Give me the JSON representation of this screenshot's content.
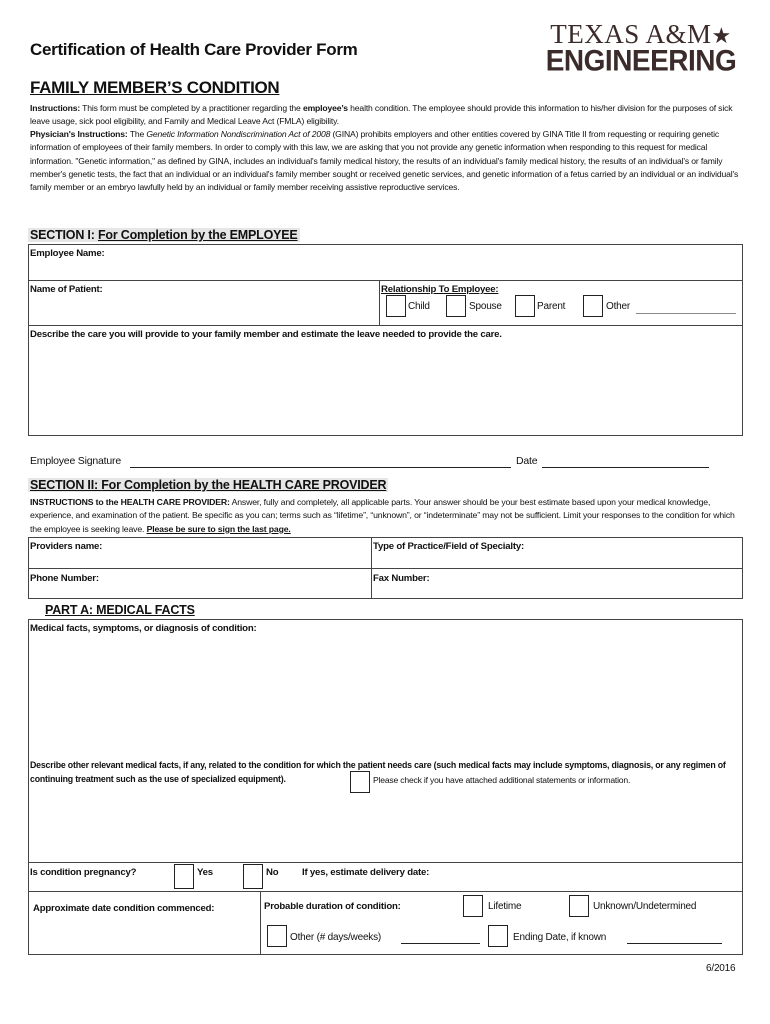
{
  "header": {
    "title": "Certification of Health Care Provider Form",
    "subtitle": "FAMILY MEMBER’S CONDITION",
    "logo_line1": "TEXAS A&M",
    "logo_star": "★",
    "logo_line2": "ENGINEERING"
  },
  "instructions": {
    "label": "Instructions:",
    "text_a": " This form must be completed by a practitioner regarding the ",
    "employee_bold": "employee’s",
    "text_b": " health condition. The employee should provide this information to his/her division for the purposes of sick leave usage, sick pool eligibility, and Family and Medical Leave Act (FMLA) eligibility.",
    "physician_label": "Physician's Instructions:",
    "physician_a": " The ",
    "gina_italic": "Genetic Information Nondiscrimination Act of 2008",
    "physician_b": " (GINA) prohibits employers and other entities covered by GINA Title II from requesting or requiring genetic information of employees of their family members. In order to comply with this law, we are asking that you not provide any genetic information when responding to this request for medical information. \"Genetic information,\" as defined by GINA, includes an individual's family medical history, the results of an individual's family medical history, the results of an individual's or family member's genetic tests, the fact that an individual or an individual's family member sought or received genetic services, and genetic information of a fetus carried by an individual or an individual's family member or an embryo lawfully held by an individual or family member receiving assistive reproductive services."
  },
  "section1": {
    "prefix": "SECTION I:  ",
    "heading": "For Completion by the EMPLOYEE",
    "employee_name_label": "Employee Name:",
    "patient_name_label": "Name of Patient:",
    "relationship_label": "Relationship To Employee:",
    "relationship_options": [
      "Child",
      "Spouse",
      "Parent",
      "Other"
    ],
    "care_label": "Describe the care you will provide to your family member and estimate the leave needed to provide the care.",
    "signature_label": "Employee Signature",
    "date_label": "Date"
  },
  "section2": {
    "prefix": "SECTION II: ",
    "heading": "For Completion by the HEALTH CARE PROVIDER",
    "instr_label": "INSTRUCTIONS to the HEALTH CARE PROVIDER:",
    "instr_text": " Answer, fully and completely, all applicable parts. Your answer should be your best estimate based upon your medical knowledge, experience, and examination of the patient. Be specific as you can; terms such as “lifetime”, “unknown”, or “indeterminate” may not be sufficient. Limit your responses to the condition for which the employee is seeking leave. ",
    "instr_emphasis": "Please be sure to sign the last page.",
    "providers_name_label": "Providers name:",
    "practice_label": "Type of Practice/Field of Specialty:",
    "phone_label": "Phone Number:",
    "fax_label": "Fax Number:"
  },
  "partA": {
    "heading": "PART A: MEDICAL FACTS",
    "facts_label": "Medical facts, symptoms, or diagnosis of condition:",
    "other_facts_label": "Describe other relevant medical facts, if any, related to the condition for which the patient needs care (such medical facts may include symptoms, diagnosis, or any regimen of continuing treatment such as the use of specialized equipment).",
    "attached_label": "Please check if you have attached additional statements or information.",
    "pregnancy_label": "Is condition pregnancy?",
    "yes_label": "Yes",
    "no_label": "No",
    "delivery_label": "If yes, estimate delivery date:",
    "commenced_label": "Approximate date condition commenced:",
    "duration_label": "Probable duration of condition:",
    "lifetime_label": "Lifetime",
    "unknown_label": "Unknown/Undetermined",
    "other_days_label": "Other (# days/weeks)",
    "ending_date_label": "Ending Date, if known"
  },
  "footer": {
    "revision": "6/2016"
  }
}
